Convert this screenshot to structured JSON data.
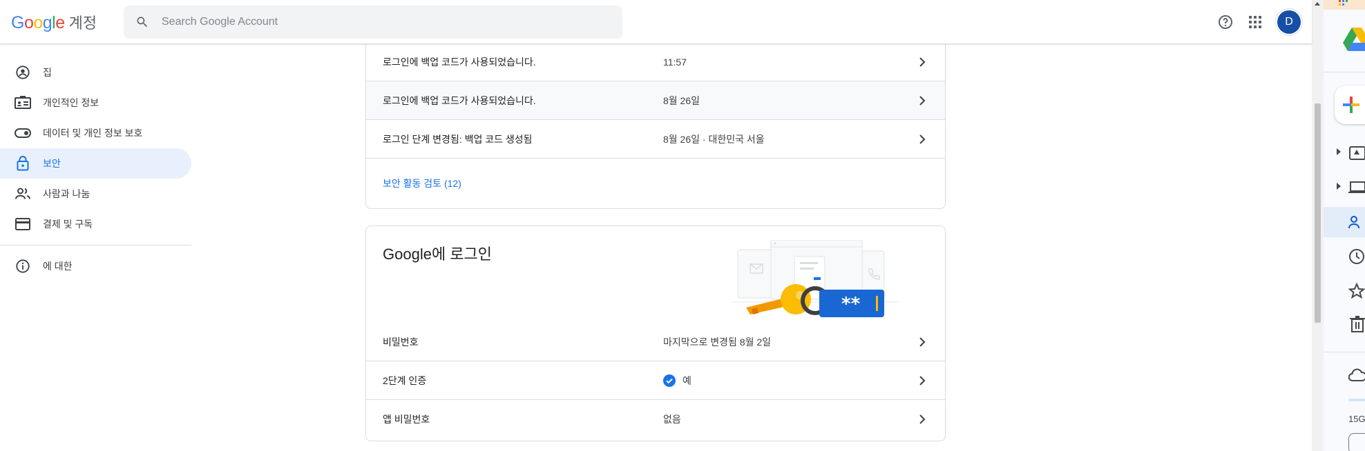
{
  "header": {
    "logo_letters": [
      "G",
      "o",
      "o",
      "g",
      "l",
      "e"
    ],
    "product": "계정",
    "search_placeholder": "Search Google Account",
    "avatar_letter": "D"
  },
  "sidebar": {
    "items": [
      {
        "label": "집",
        "icon": "account-circle-icon"
      },
      {
        "label": "개인적인 정보",
        "icon": "id-card-icon"
      },
      {
        "label": "데이터 및 개인 정보 보호",
        "icon": "toggle-icon"
      },
      {
        "label": "보안",
        "icon": "lock-icon",
        "active": true
      },
      {
        "label": "사람과 나눔",
        "icon": "people-icon"
      },
      {
        "label": "결제 및 구독",
        "icon": "credit-card-icon"
      }
    ],
    "about": {
      "label": "에 대한",
      "icon": "info-icon"
    }
  },
  "security_activity": {
    "rows": [
      {
        "label": "로그인에 백업 코드가 사용되었습니다.",
        "value": "11:57"
      },
      {
        "label": "로그인에 백업 코드가 사용되었습니다.",
        "value": "8월 26일"
      },
      {
        "label": "로그인 단계 변경됨: 백업 코드 생성됨",
        "value": "8월 26일 · 대한민국 서울"
      }
    ],
    "review_link": "보안 활동 검토 (12)"
  },
  "signin": {
    "title": "Google에 로그인",
    "illustration_text": "**",
    "rows": [
      {
        "label": "비밀번호",
        "value": "마지막으로 변경됨 8월 2일"
      },
      {
        "label": "2단계 인증",
        "value": "예"
      },
      {
        "label": "앱 비밀번호",
        "value": "없음"
      }
    ]
  },
  "colors": {
    "accent": "#1a73e8",
    "active_bg": "#e8f0fe",
    "divider": "#dadce0"
  }
}
